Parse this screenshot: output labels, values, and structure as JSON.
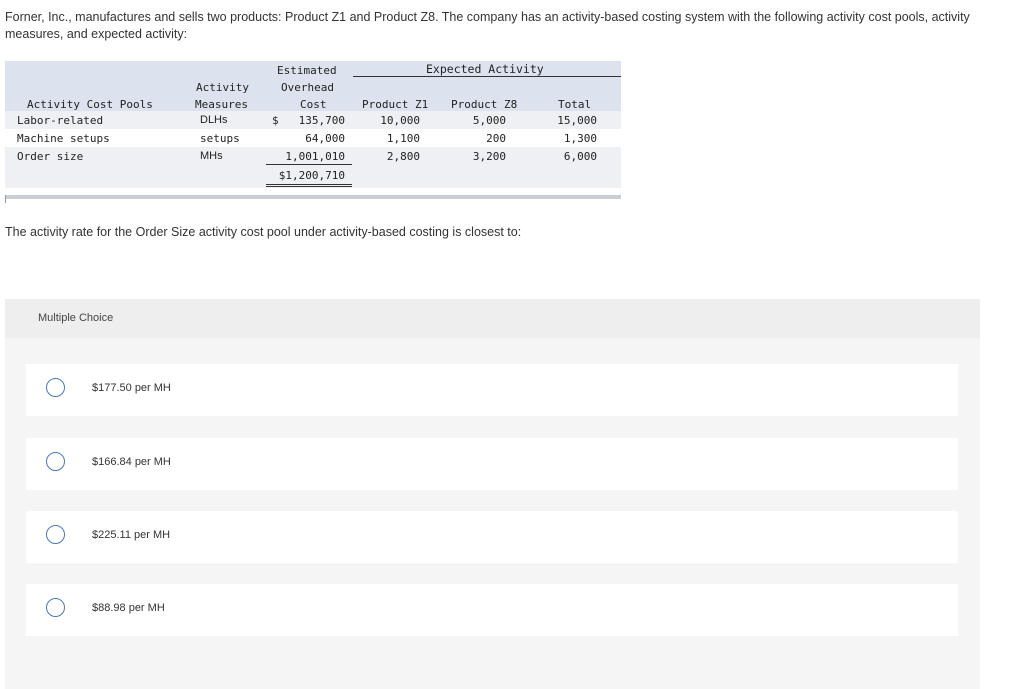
{
  "intro": "Forner, Inc., manufactures and sells two products: Product Z1 and Product Z8. The company has an activity-based costing system with the following activity cost pools, activity measures, and expected activity:",
  "table": {
    "headers": {
      "pools": "Activity Cost Pools",
      "activity": "Activity",
      "measures": "Measures",
      "estimated": "Estimated",
      "overhead": "Overhead",
      "cost": "Cost",
      "expected": "Expected Activity",
      "z1": "Product Z1",
      "z8": "Product Z8",
      "total": "Total"
    },
    "rows": [
      {
        "pool": "Labor-related",
        "measure": "DLHs",
        "dollar": "$",
        "cost": "135,700",
        "z1": "10,000",
        "z8": "5,000",
        "total": "15,000"
      },
      {
        "pool": "Machine setups",
        "measure": "setups",
        "dollar": "",
        "cost": "64,000",
        "z1": "1,100",
        "z8": "200",
        "total": "1,300"
      },
      {
        "pool": "Order size",
        "measure": "MHs",
        "dollar": "",
        "cost": "1,001,010",
        "z1": "2,800",
        "z8": "3,200",
        "total": "6,000"
      }
    ],
    "grand_total": "$1,200,710"
  },
  "question": "The activity rate for the Order Size activity cost pool under activity-based costing is closest to:",
  "multiple_choice": {
    "label": "Multiple Choice",
    "options": [
      "$177.50 per MH",
      "$166.84 per MH",
      "$225.11 per MH",
      "$88.98 per MH"
    ]
  }
}
